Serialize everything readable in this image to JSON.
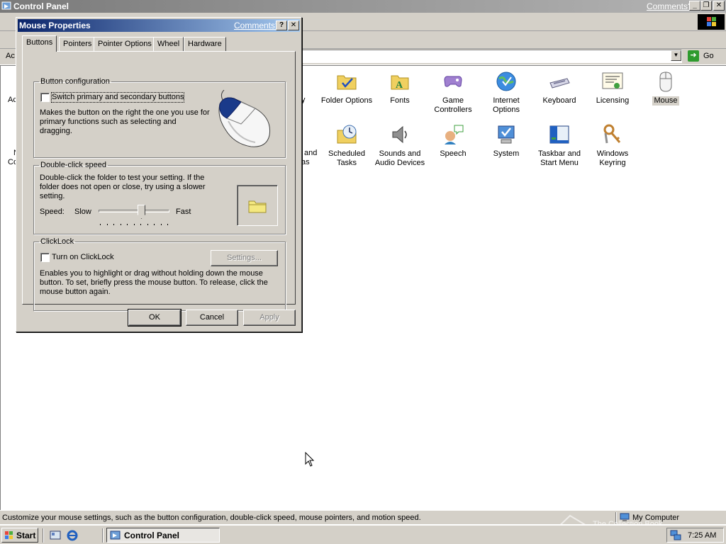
{
  "cp_window": {
    "title": "Control Panel",
    "comments_link": "Comments?",
    "address_label": "Ac",
    "go_label": "Go",
    "items": [
      {
        "label": "Folder Options",
        "icon": "folder-options-icon"
      },
      {
        "label": "Fonts",
        "icon": "fonts-icon"
      },
      {
        "label": "Game Controllers",
        "icon": "game-controllers-icon"
      },
      {
        "label": "Internet Options",
        "icon": "internet-options-icon"
      },
      {
        "label": "Keyboard",
        "icon": "keyboard-icon"
      },
      {
        "label": "Licensing",
        "icon": "licensing-icon"
      },
      {
        "label": "Mouse",
        "icon": "mouse-icon"
      },
      {
        "label": "Scheduled Tasks",
        "icon": "scheduled-tasks-icon"
      },
      {
        "label": "Sounds and Audio Devices",
        "icon": "sounds-icon"
      },
      {
        "label": "Speech",
        "icon": "speech-icon"
      },
      {
        "label": "System",
        "icon": "system-icon"
      },
      {
        "label": "Taskbar and Start Menu",
        "icon": "taskbar-icon"
      },
      {
        "label": "Windows Keyring",
        "icon": "keyring-icon"
      }
    ],
    "partial_labels": {
      "left_top_1": "Ac",
      "left_top_2": "N",
      "left_mid": "Co",
      "mid_top": "y",
      "mid_2": "and",
      "mid_3": "as"
    },
    "status_text": "Customize your mouse settings, such as the button configuration, double-click speed, mouse pointers, and motion speed.",
    "status_zone": "My Computer"
  },
  "dialog": {
    "title": "Mouse Properties",
    "comments_link": "Comments?",
    "tabs": [
      "Buttons",
      "Pointers",
      "Pointer Options",
      "Wheel",
      "Hardware"
    ],
    "active_tab": "Buttons",
    "button_config": {
      "legend": "Button configuration",
      "switch_label": "Switch primary and secondary buttons",
      "switch_checked": false,
      "description": "Makes the button on the right the one you use for primary functions such as selecting and dragging."
    },
    "double_click": {
      "legend": "Double-click speed",
      "description": "Double-click the folder to test your setting. If the folder does not open or close, try using a slower setting.",
      "speed_label": "Speed:",
      "slow_label": "Slow",
      "fast_label": "Fast",
      "speed_value": 0.6
    },
    "clicklock": {
      "legend": "ClickLock",
      "checkbox_label": "Turn on ClickLock",
      "checked": false,
      "settings_label": "Settings...",
      "description": "Enables you to highlight or drag without holding down the mouse button. To set, briefly press the mouse button. To release, click the mouse button again."
    },
    "buttons": {
      "ok": "OK",
      "cancel": "Cancel",
      "apply": "Apply"
    }
  },
  "taskbar": {
    "start_label": "Start",
    "task_label": "Control Panel",
    "clock": "7:25 AM"
  },
  "watermark": "The Collection Book"
}
